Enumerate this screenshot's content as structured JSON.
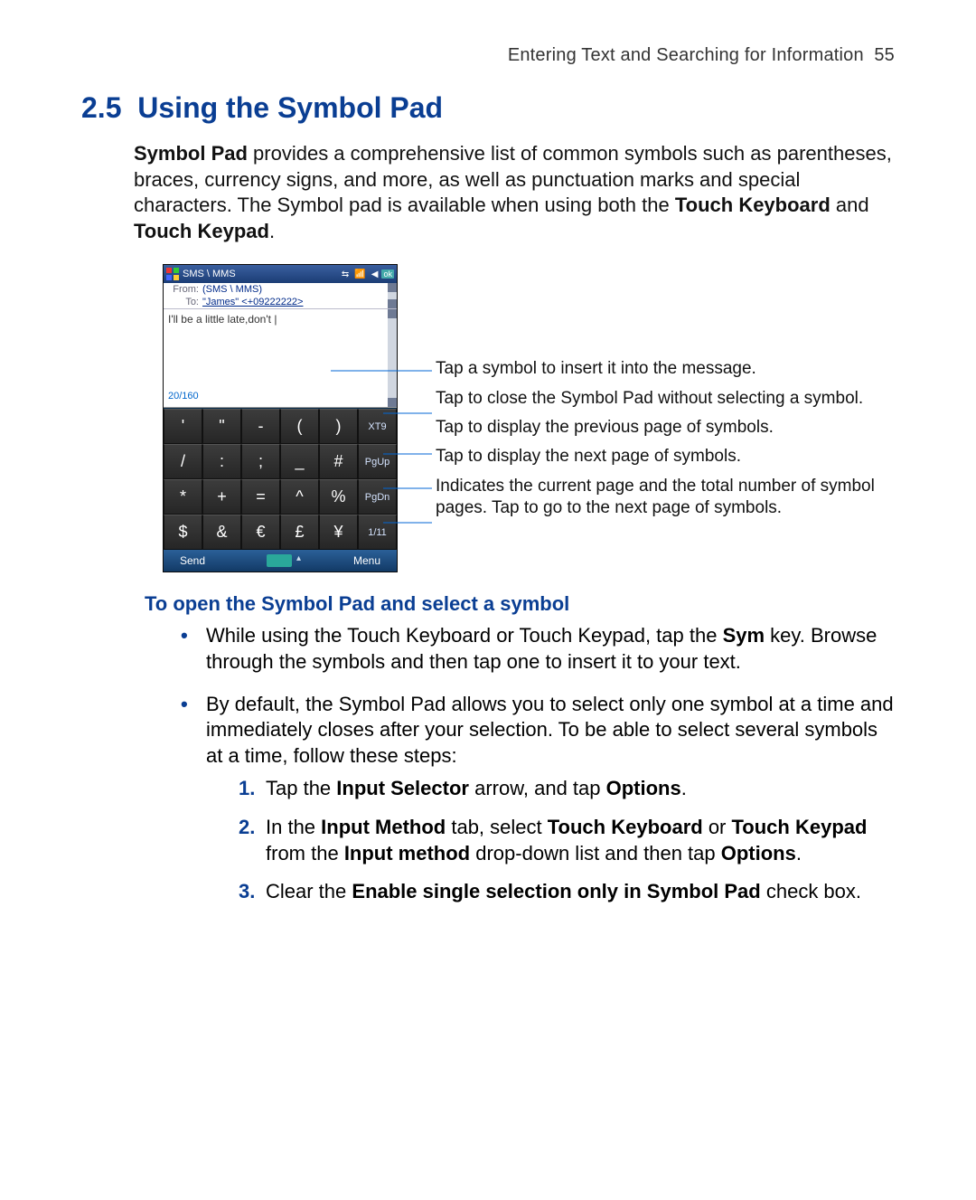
{
  "header": {
    "chapter_title": "Entering Text and Searching for Information",
    "page_number": "55"
  },
  "section": {
    "number": "2.5",
    "title": "Using the Symbol Pad"
  },
  "intro": {
    "lead_bold": "Symbol Pad",
    "text_after_lead": " provides a comprehensive list of common symbols such as parentheses, braces, currency signs, and more, as well as punctuation marks and special characters. The Symbol pad is available when using both the ",
    "bold2": "Touch Keyboard",
    "mid": " and ",
    "bold3": "Touch Keypad",
    "tail": "."
  },
  "phone": {
    "title": "SMS \\ MMS",
    "ok": "ok",
    "from_label": "From:",
    "from_value": "(SMS \\ MMS)",
    "to_label": "To:",
    "to_value": "\"James\" <+09222222>",
    "compose_text": "I'll be a little late,don't |",
    "char_count": "20/160",
    "rows": [
      [
        "'",
        "\"",
        "-",
        "(",
        ")",
        "XT9"
      ],
      [
        "/",
        ":",
        ";",
        "_",
        "#",
        "PgUp"
      ],
      [
        "*",
        "+",
        "=",
        "^",
        "%",
        "PgDn"
      ],
      [
        "$",
        "&",
        "€",
        "£",
        "¥",
        "1/11"
      ]
    ],
    "bottom": {
      "send": "Send",
      "menu": "Menu"
    }
  },
  "callouts": {
    "c1": "Tap a symbol to insert it into the message.",
    "c2": "Tap to close the Symbol Pad without selecting a symbol.",
    "c3": "Tap to display the previous page of symbols.",
    "c4": "Tap to display the next page of symbols.",
    "c5": "Indicates the current page and the total number of symbol pages. Tap to go to the next page of symbols."
  },
  "subheading": "To open the Symbol Pad and select a symbol",
  "bullet1": {
    "pre": "While using the Touch Keyboard or Touch Keypad, tap the ",
    "b1": "Sym",
    "post": " key. Browse through the symbols and then tap one to insert it to your text."
  },
  "bullet2": "By default, the Symbol Pad allows you to select only one symbol at a time and immediately closes after your selection. To be able to select several symbols at a time, follow these steps:",
  "step1": {
    "pre": "Tap the ",
    "b1": "Input Selector",
    "mid": " arrow, and tap ",
    "b2": "Options",
    "post": "."
  },
  "step2": {
    "pre": "In the ",
    "b1": "Input Method",
    "m1": " tab, select ",
    "b2": "Touch Keyboard",
    "m2": " or ",
    "b3": "Touch Keypad",
    "m3": " from the ",
    "b4": "Input method",
    "m4": " drop-down list and then tap ",
    "b5": "Options",
    "post": "."
  },
  "step3": {
    "pre": "Clear the ",
    "b1": "Enable single selection only in Symbol Pad",
    "post": " check box."
  }
}
